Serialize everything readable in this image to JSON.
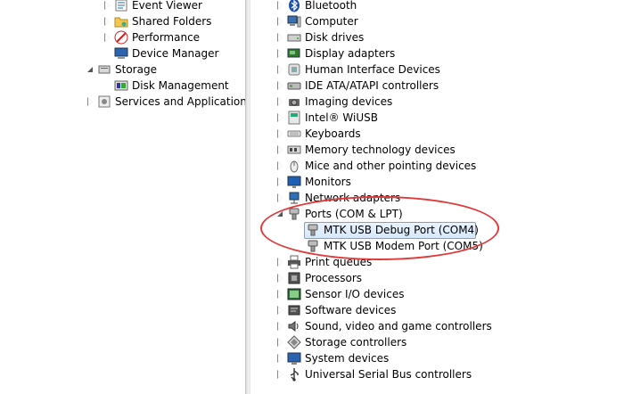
{
  "left_tree": [
    {
      "label": "Event Viewer",
      "icon": "event-viewer-icon",
      "twisty": "closed",
      "depth": 2
    },
    {
      "label": "Shared Folders",
      "icon": "shared-folders-icon",
      "twisty": "closed",
      "depth": 2
    },
    {
      "label": "Performance",
      "icon": "performance-icon",
      "twisty": "closed",
      "depth": 2
    },
    {
      "label": "Device Manager",
      "icon": "device-manager-icon",
      "twisty": "none",
      "depth": 2
    },
    {
      "label": "Storage",
      "icon": "storage-icon",
      "twisty": "open",
      "depth": 1
    },
    {
      "label": "Disk Management",
      "icon": "disk-management-icon",
      "twisty": "none",
      "depth": 2
    },
    {
      "label": "Services and Applications",
      "icon": "services-icon",
      "twisty": "closed",
      "depth": 1
    }
  ],
  "device_tree": [
    {
      "label": "Bluetooth",
      "icon": "bluetooth-icon",
      "twisty": "closed"
    },
    {
      "label": "Computer",
      "icon": "computer-icon",
      "twisty": "closed"
    },
    {
      "label": "Disk drives",
      "icon": "disk-drive-icon",
      "twisty": "closed"
    },
    {
      "label": "Display adapters",
      "icon": "display-adapter-icon",
      "twisty": "closed"
    },
    {
      "label": "Human Interface Devices",
      "icon": "hid-icon",
      "twisty": "closed"
    },
    {
      "label": "IDE ATA/ATAPI controllers",
      "icon": "ide-controller-icon",
      "twisty": "closed"
    },
    {
      "label": "Imaging devices",
      "icon": "camera-icon",
      "twisty": "closed"
    },
    {
      "label": "Intel® WiUSB",
      "icon": "wiusb-icon",
      "twisty": "closed"
    },
    {
      "label": "Keyboards",
      "icon": "keyboard-icon",
      "twisty": "closed"
    },
    {
      "label": "Memory technology devices",
      "icon": "memory-icon",
      "twisty": "closed"
    },
    {
      "label": "Mice and other pointing devices",
      "icon": "mouse-icon",
      "twisty": "closed"
    },
    {
      "label": "Monitors",
      "icon": "monitor-icon",
      "twisty": "closed"
    },
    {
      "label": "Network adapters",
      "icon": "network-adapter-icon",
      "twisty": "closed"
    },
    {
      "label": "Ports (COM & LPT)",
      "icon": "port-icon",
      "twisty": "open"
    },
    {
      "label": "MTK USB Debug Port (COM4)",
      "icon": "port-icon",
      "twisty": "child",
      "selected": true
    },
    {
      "label": "MTK USB Modem Port (COM5)",
      "icon": "port-icon",
      "twisty": "child"
    },
    {
      "label": "Print queues",
      "icon": "printer-icon",
      "twisty": "closed"
    },
    {
      "label": "Processors",
      "icon": "processor-icon",
      "twisty": "closed"
    },
    {
      "label": "Sensor I/O devices",
      "icon": "sensor-icon",
      "twisty": "closed"
    },
    {
      "label": "Software devices",
      "icon": "software-device-icon",
      "twisty": "closed"
    },
    {
      "label": "Sound, video and game controllers",
      "icon": "sound-icon",
      "twisty": "closed"
    },
    {
      "label": "Storage controllers",
      "icon": "storage-controller-icon",
      "twisty": "closed"
    },
    {
      "label": "System devices",
      "icon": "system-device-icon",
      "twisty": "closed"
    },
    {
      "label": "Universal Serial Bus controllers",
      "icon": "usb-icon",
      "twisty": "closed"
    }
  ],
  "colors": {
    "annotation": "#e03a3a",
    "selection_border": "#7da2ce"
  }
}
